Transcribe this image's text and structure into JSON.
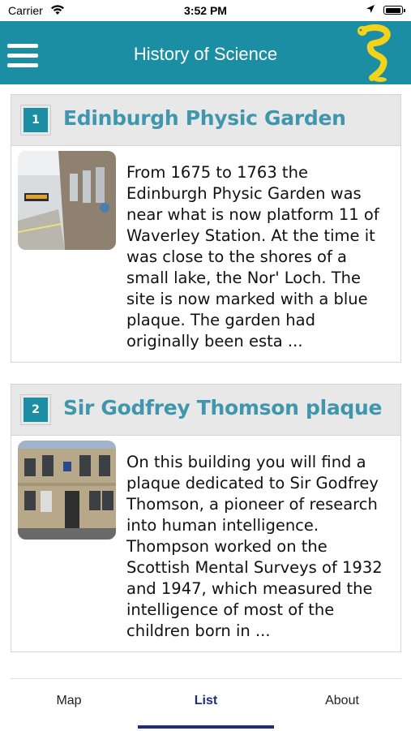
{
  "status_bar": {
    "carrier": "Carrier",
    "time": "3:52 PM"
  },
  "header": {
    "title": "History of Science",
    "logo_icon": "serpent-logo-icon"
  },
  "items": [
    {
      "number": "1",
      "title": "Edinburgh Physic Garden",
      "description": "From 1675 to 1763 the Edinburgh Physic Garden was near what is now platform 11 of Waverley Station. At the time it was close to the shores of a small lake, the Nor' Loch. The site is now marked with a blue plaque. The garden had originally been esta ..."
    },
    {
      "number": "2",
      "title": "Sir Godfrey Thomson plaque",
      "description": "On this building you will find a plaque dedicated to Sir Godfrey Thomson, a pioneer of research into human intelligence. Thompson worked on the Scottish Mental Surveys of 1932 and 1947, which measured the intelligence of most of the children born in ..."
    }
  ],
  "tabs": [
    {
      "label": "Map",
      "active": false
    },
    {
      "label": "List",
      "active": true
    },
    {
      "label": "About",
      "active": false
    }
  ],
  "colors": {
    "header": "#1c8ea3",
    "title": "#3f96ad",
    "active_tab": "#1f2d7a",
    "logo": "#f2d21b"
  }
}
